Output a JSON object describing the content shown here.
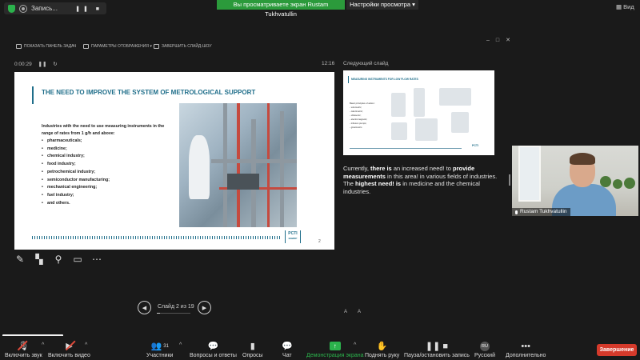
{
  "topbar": {
    "recording_label": "Запись...",
    "share_banner": "Вы просматриваете экран Rustam Tukhvatullin",
    "view_settings": "Настройки просмотра ▾",
    "view_button": "Вид"
  },
  "presenter_toolbar": {
    "show_taskbar": "ПОКАЗАТЬ ПАНЕЛЬ ЗАДАЧ",
    "display_settings": "ПАРАМЕТРЫ ОТОБРАЖЕНИЯ ▾",
    "end_show": "ЗАВЕРШИТЬ СЛАЙД-ШОУ"
  },
  "timer": {
    "elapsed": "0:00:29",
    "clock": "12:16"
  },
  "next_slide": {
    "header": "Следующий слайд",
    "title": "MEASURING INSTRUMENTS FOR LOW FLOW RATES",
    "principles": [
      "Basic principles of action:",
      "- volumetric;",
      "- calorimetric;",
      "- ultrasonic;",
      "- electromagnetic;",
      "- infusion pumps;",
      "- gravimetric."
    ],
    "logo": "PCTI"
  },
  "slide": {
    "title": "THE NEED TO IMPROVE THE SYSTEM OF METROLOGICAL SUPPORT",
    "intro": "Industries with the need to use measuring instruments in the range of rates from 1 g/h and above:",
    "items": [
      "pharmaceuticals;",
      "medicine;",
      "chemical industry;",
      "food industry;",
      "petrochemical industry;",
      "semiconductor manufacturing;",
      "mechanical engineering;",
      "fuel industry;",
      "and others."
    ],
    "logo_top": "PCTI",
    "logo_bottom": "ВНИИР",
    "page_number": "2"
  },
  "notes": {
    "parts": [
      {
        "text": "Currently, ",
        "bold": false
      },
      {
        "text": "there is",
        "bold": true
      },
      {
        "text": " an increased need! to ",
        "bold": false
      },
      {
        "text": "provide measurements",
        "bold": true
      },
      {
        "text": " in this area! in various fields of industries. The ",
        "bold": false
      },
      {
        "text": "highest need! is",
        "bold": true
      },
      {
        "text": " in medicine and the chemical industries.",
        "bold": false
      }
    ]
  },
  "slide_nav": {
    "counter": "Слайд 2 из 19",
    "progress": 0.105
  },
  "video": {
    "name": "Rustam Tukhvatullin"
  },
  "toolbar": {
    "unmute": "Включить звук",
    "start_video": "Включить видео",
    "participants": "Участники",
    "participants_count": "31",
    "qa": "Вопросы и ответы",
    "polls": "Опросы",
    "chat": "Чат",
    "share_screen": "Демонстрация экрана",
    "raise_hand": "Поднять руку",
    "pause_recording": "Пауза/остановить запись",
    "language": "Русский",
    "language_code": "RU",
    "more": "Дополнительно",
    "end": "Завершение"
  },
  "colors": {
    "accent_green": "#2bb24c",
    "end_red": "#d53a2b",
    "slide_blue": "#1f6e8a"
  }
}
